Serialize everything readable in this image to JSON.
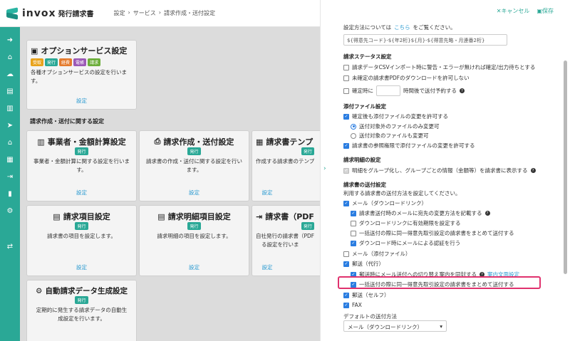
{
  "app": {
    "logo_text": "invox",
    "logo_sub": "発行請求書"
  },
  "breadcrumb": [
    "設定",
    "›",
    "サービス",
    "›",
    "請求作成・送付設定"
  ],
  "sidebar": {
    "icons": [
      "arrow-right-circle-icon",
      "home-icon",
      "upload-cloud-icon",
      "document-icon",
      "document-icon",
      "send-icon",
      "bank-icon",
      "building-icon",
      "export-icon",
      "chart-icon",
      "gear-icon",
      "transfer-icon"
    ]
  },
  "cards": {
    "option": {
      "title": "オプションサービス設定",
      "tags": [
        "受取",
        "発行",
        "経費",
        "電帳",
        "請求"
      ],
      "desc": "各種オプションサービスの設定を行います。",
      "link": "設定"
    },
    "section_heading": "請求作成・送付に関する設定",
    "business": {
      "title": "事業者・金額計算設定",
      "tag": "発行",
      "desc": "事業者・金額計算に関する設定を行います。",
      "link": "設定"
    },
    "create_send": {
      "title": "請求作成・送付設定",
      "tag": "発行",
      "desc": "請求書の作成・送付に関する設定を行います。",
      "link": "設定"
    },
    "template": {
      "title": "請求書テンプ",
      "tag": "発行",
      "desc": "作成する請求書のテンプ",
      "link": "設定"
    },
    "item": {
      "title": "請求項目設定",
      "tag": "発行",
      "desc": "請求書の項目を設定します。",
      "link": "設定"
    },
    "detail_item": {
      "title": "請求明細項目設定",
      "tag": "発行",
      "desc": "請求明細の項目を設定します。",
      "link": "設定"
    },
    "pdf": {
      "title": "請求書（PDF",
      "tag": "発行",
      "desc": "自社発行の請求書（PDF",
      "desc2": "る設定を行いま",
      "link": "設定"
    },
    "auto": {
      "title": "自動請求データ生成設定",
      "tag": "発行",
      "desc": "定期的に発生する請求データの自動生成設定を行います。"
    }
  },
  "panel": {
    "cancel": "キャンセル",
    "save": "保存",
    "ref_pre": "設定方法については",
    "ref_link": "こちら",
    "ref_post": "をご覧ください。",
    "filename_value": "${得意先コード}-${年2桁}${月}-${得意先略・月連番2桁}",
    "status_head": "請求ステータス設定",
    "status_1": "請求データCSVインポート時に警告・エラーが無ければ確定/出力待ちとする",
    "status_2": "未確定の請求書PDFのダウンロードを許可しない",
    "status_3a": "確定時に",
    "status_3b": "時間後で送付予約する",
    "attach_head": "添付ファイル設定",
    "attach_1": "確定後も添付ファイルの変更を許可する",
    "attach_r1": "送付対象外のファイルのみ変更可",
    "attach_r2": "送付対象のファイルも変更可",
    "attach_2": "請求書の参照権限で添付ファイルの変更を許可する",
    "detail_head": "請求明細の設定",
    "detail_1": "明細をグループ化し、グループごとの情報（金額等）を請求書に表示する",
    "send_head": "請求書の送付設定",
    "send_desc": "利用する請求書の送付方法を設定してください。",
    "mail_dl": "メール（ダウンロードリンク）",
    "mail_dl_1": "請求書送付時のメールに宛先の変更方法を記載する",
    "mail_dl_2": "ダウンロードリンクに有効期限を設定する",
    "mail_dl_3": "一括送付の際に同一得意先取引設定の請求書をまとめて送付する",
    "mail_dl_4": "ダウンロード時にメールによる認証を行う",
    "mail_att": "メール（添付ファイル）",
    "post": "郵送（代行）",
    "post_1": "郵送時にメール送付への切り替え案内を同封する",
    "post_1_link": "案内文面設定",
    "post_2": "一括送付の際に同一得意先取引設定の請求書をまとめて送付する",
    "post_self": "郵送（セルフ）",
    "fax": "FAX",
    "default_head": "デフォルトの送付方法",
    "default_value": "メール（ダウンロードリンク）"
  }
}
